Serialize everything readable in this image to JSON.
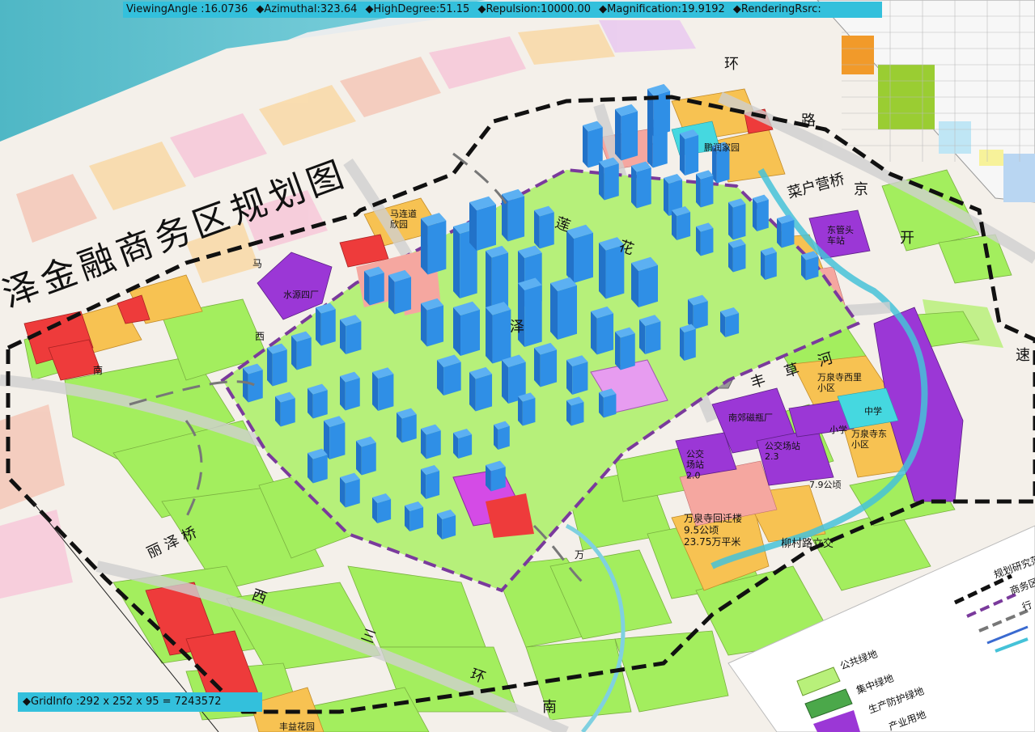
{
  "hud": {
    "viewing_angle": "ViewingAngle :16.0736",
    "azimuthal": "◆Azimuthal:323.64",
    "high_degree": "◆HighDegree:51.15",
    "repulsion": "◆Repulsion:10000.00",
    "magnification": "◆Magnification:19.9192",
    "rendering": "◆RenderingRsrc:",
    "grid_info": "◆GridInfo :292 x 252 x 95 = 7243572"
  },
  "map": {
    "title": "泽金融商务区规划图",
    "places": {
      "mazhi": "马连道\n欣园",
      "shuiyuan": "水源四厂",
      "lianhua_park": "鹏润家园",
      "dongguan": "东管头\n车站",
      "wanquan_xili": "万泉寺西里\n小区",
      "south_park": "南郊磁瓶厂",
      "wanquan_dongli": "万泉寺东\n小区",
      "huikan": "万泉寺回迁楼\n9.5公顷\n23.75万平米",
      "bus1": "公交\n场站\n2.0",
      "bus2": "公交场站\n2.3",
      "green79": "7.9公顷",
      "school1": "小学",
      "school2": "中学",
      "liucun": "柳村路立交",
      "fengyi": "丰益花园",
      "fengyi_yuan": "丰益花园"
    },
    "roads": {
      "lize": "丽 泽 桥",
      "xisanhuan": "西 三 环",
      "south": "南",
      "jing": "京",
      "kai": "开",
      "huan": "环",
      "lu": "路",
      "road_e": "莲 花",
      "road_f": "泽",
      "caoqiao": "菜户营桥",
      "fengcao": "丰 草 河",
      "nan": "南",
      "ma": "马",
      "west": "西",
      "wanlu": "万",
      "su": "速"
    },
    "legend": {
      "l1": "规划研究范",
      "l2": "商务区",
      "l3": "行",
      "g1": "公共绿地",
      "g2": "集中绿地",
      "g3": "生产防护绿地",
      "g4": "产业用地"
    },
    "colors": {
      "residential": "#f7c252",
      "green": "#a3ee5e",
      "commercial": "#ee3b3b",
      "industry": "#9b37d6",
      "building": "#2f8fe6",
      "water": "#45c2d8",
      "dash": "#111111",
      "purple_dash": "#7a3a9c"
    }
  }
}
